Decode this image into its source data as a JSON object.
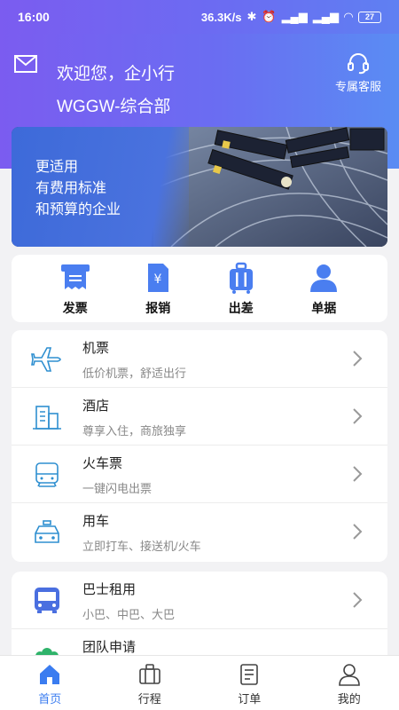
{
  "status_bar": {
    "time": "16:00",
    "speed": "36.3K/s",
    "battery": "27"
  },
  "header": {
    "welcome": "欢迎您，企小行",
    "department": "WGGW-综合部",
    "customer_service": "专属客服"
  },
  "banner": {
    "line1": "更适用",
    "line2": "有费用标准",
    "line3": "和预算的企业"
  },
  "quick_actions": [
    {
      "label": "发票",
      "icon": "invoice-icon"
    },
    {
      "label": "报销",
      "icon": "reimburse-icon"
    },
    {
      "label": "出差",
      "icon": "luggage-icon"
    },
    {
      "label": "单据",
      "icon": "person-icon"
    }
  ],
  "services": [
    {
      "title": "机票",
      "subtitle": "低价机票，舒适出行",
      "icon": "plane-icon"
    },
    {
      "title": "酒店",
      "subtitle": "尊享入住，商旅独享",
      "icon": "hotel-icon"
    },
    {
      "title": "火车票",
      "subtitle": "一键闪电出票",
      "icon": "train-icon"
    },
    {
      "title": "用车",
      "subtitle": "立即打车、接送机/火车",
      "icon": "taxi-icon"
    }
  ],
  "services2": [
    {
      "title": "巴士租用",
      "subtitle": "小巴、中巴、大巴",
      "icon": "bus-icon"
    },
    {
      "title": "团队申请",
      "subtitle": "",
      "icon": "team-icon"
    }
  ],
  "tabs": [
    {
      "label": "首页",
      "icon": "home-icon"
    },
    {
      "label": "行程",
      "icon": "suitcase-icon"
    },
    {
      "label": "订单",
      "icon": "order-icon"
    },
    {
      "label": "我的",
      "icon": "profile-icon"
    }
  ],
  "colors": {
    "accent": "#3a7cf0",
    "header_start": "#7b5cf0",
    "header_end": "#5a8cf3",
    "icon_blue": "#4a7ef0"
  }
}
